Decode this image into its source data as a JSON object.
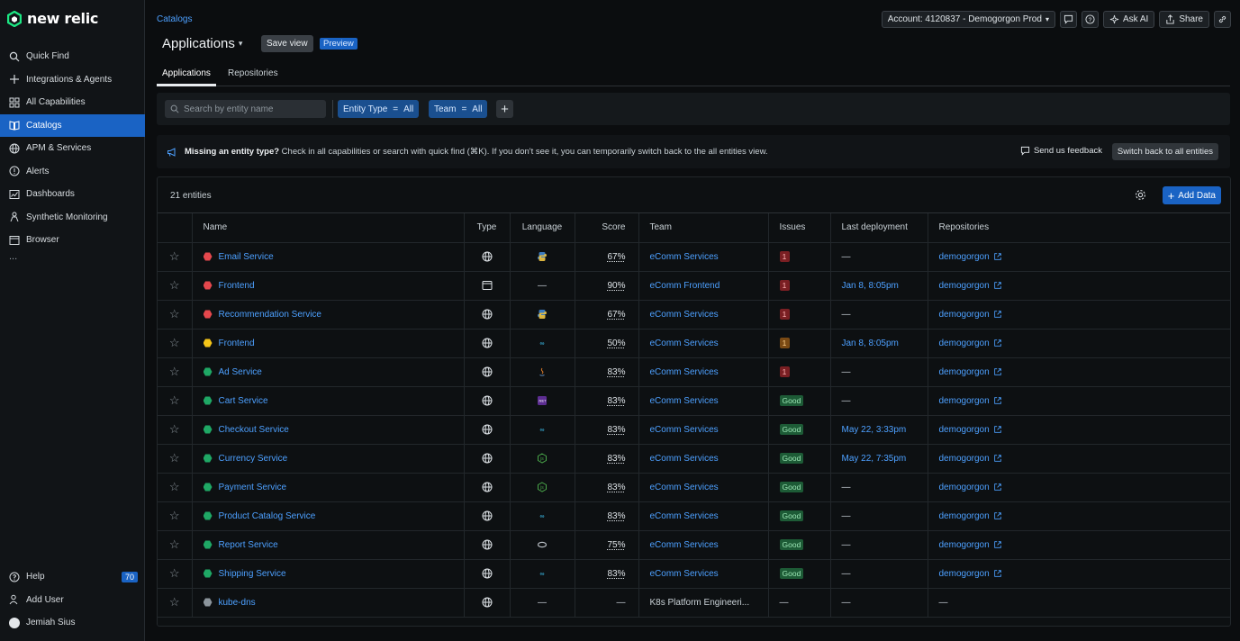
{
  "brand": {
    "name": "new relic"
  },
  "sidebar": {
    "items": [
      {
        "label": "Quick Find",
        "icon": "search-icon"
      },
      {
        "label": "Integrations & Agents",
        "icon": "plus-icon"
      },
      {
        "label": "All Capabilities",
        "icon": "grid-icon"
      },
      {
        "label": "Catalogs",
        "icon": "book-icon",
        "active": true
      },
      {
        "label": "APM & Services",
        "icon": "globe-icon"
      },
      {
        "label": "Alerts",
        "icon": "alert-icon"
      },
      {
        "label": "Dashboards",
        "icon": "dashboard-icon"
      },
      {
        "label": "Synthetic Monitoring",
        "icon": "person-icon"
      },
      {
        "label": "Browser",
        "icon": "browser-icon"
      }
    ],
    "more": "...",
    "bottom": [
      {
        "label": "Help",
        "icon": "help-icon",
        "badge": "70"
      },
      {
        "label": "Add User",
        "icon": "add-user-icon"
      },
      {
        "label": "Jemiah Sius",
        "icon": "avatar"
      }
    ]
  },
  "header": {
    "breadcrumb": "Catalogs",
    "title": "Applications",
    "save_view": "Save view",
    "preview": "Preview",
    "account": "Account: 4120837 - Demogorgon Prod",
    "ask_ai": "Ask AI",
    "share": "Share"
  },
  "tabs": [
    {
      "label": "Applications",
      "active": true
    },
    {
      "label": "Repositories"
    }
  ],
  "filters": {
    "search_placeholder": "Search by entity name",
    "chips": [
      {
        "key": "Entity Type",
        "op": "=",
        "value": "All"
      },
      {
        "key": "Team",
        "op": "=",
        "value": "All"
      }
    ]
  },
  "banner": {
    "bold": "Missing an entity type?",
    "text": " Check in all capabilities or search with quick find (⌘K). If you don't see it, you can temporarily switch back to the all entities view.",
    "feedback": "Send us feedback",
    "switch": "Switch back to all entities"
  },
  "panel": {
    "count": "21 entities",
    "add_data": "Add Data",
    "columns": [
      "Name",
      "Type",
      "Language",
      "Score",
      "Team",
      "Issues",
      "Last deployment",
      "Repositories"
    ]
  },
  "colors": {
    "red": "#e5484d",
    "yellow": "#f5c518",
    "green": "#1fa865",
    "gray": "#8c959c",
    "accent": "#1a63c4"
  },
  "rows": [
    {
      "name": "Email Service",
      "status": "red",
      "type": "globe-icon",
      "lang": "python-icon",
      "score": "67%",
      "team": "eComm Services",
      "issue": "1",
      "issue_kind": "bad",
      "deploy": "—",
      "repo": "demogorgon"
    },
    {
      "name": "Frontend",
      "status": "red",
      "type": "browser-icon",
      "lang": "—",
      "score": "90%",
      "team": "eComm Frontend",
      "issue": "1",
      "issue_kind": "bad",
      "deploy": "Jan 8, 8:05pm",
      "repo": "demogorgon"
    },
    {
      "name": "Recommendation Service",
      "status": "red",
      "type": "globe-icon",
      "lang": "python-icon",
      "score": "67%",
      "team": "eComm Services",
      "issue": "1",
      "issue_kind": "bad",
      "deploy": "—",
      "repo": "demogorgon"
    },
    {
      "name": "Frontend",
      "status": "yellow",
      "type": "globe-icon",
      "lang": "go-icon",
      "score": "50%",
      "team": "eComm Services",
      "issue": "1",
      "issue_kind": "warn",
      "deploy": "Jan 8, 8:05pm",
      "repo": "demogorgon"
    },
    {
      "name": "Ad Service",
      "status": "green",
      "type": "globe-icon",
      "lang": "java-icon",
      "score": "83%",
      "team": "eComm Services",
      "issue": "1",
      "issue_kind": "bad",
      "deploy": "—",
      "repo": "demogorgon"
    },
    {
      "name": "Cart Service",
      "status": "green",
      "type": "globe-icon",
      "lang": "dotnet-icon",
      "score": "83%",
      "team": "eComm Services",
      "issue": "Good",
      "issue_kind": "good",
      "deploy": "—",
      "repo": "demogorgon"
    },
    {
      "name": "Checkout Service",
      "status": "green",
      "type": "globe-icon",
      "lang": "go-icon",
      "score": "83%",
      "team": "eComm Services",
      "issue": "Good",
      "issue_kind": "good",
      "deploy": "May 22, 3:33pm",
      "repo": "demogorgon"
    },
    {
      "name": "Currency Service",
      "status": "green",
      "type": "globe-icon",
      "lang": "node-icon",
      "score": "83%",
      "team": "eComm Services",
      "issue": "Good",
      "issue_kind": "good",
      "deploy": "May 22, 7:35pm",
      "repo": "demogorgon"
    },
    {
      "name": "Payment Service",
      "status": "green",
      "type": "globe-icon",
      "lang": "node-icon",
      "score": "83%",
      "team": "eComm Services",
      "issue": "Good",
      "issue_kind": "good",
      "deploy": "—",
      "repo": "demogorgon"
    },
    {
      "name": "Product Catalog Service",
      "status": "green",
      "type": "globe-icon",
      "lang": "go-icon",
      "score": "83%",
      "team": "eComm Services",
      "issue": "Good",
      "issue_kind": "good",
      "deploy": "—",
      "repo": "demogorgon"
    },
    {
      "name": "Report Service",
      "status": "green",
      "type": "globe-icon",
      "lang": "ruby-icon",
      "score": "75%",
      "team": "eComm Services",
      "issue": "Good",
      "issue_kind": "good",
      "deploy": "—",
      "repo": "demogorgon"
    },
    {
      "name": "Shipping Service",
      "status": "green",
      "type": "globe-icon",
      "lang": "go-icon",
      "score": "83%",
      "team": "eComm Services",
      "issue": "Good",
      "issue_kind": "good",
      "deploy": "—",
      "repo": "demogorgon"
    },
    {
      "name": "kube-dns",
      "status": "gray",
      "type": "globe-icon",
      "lang": "—",
      "score": "—",
      "team": "K8s Platform Engineeri...",
      "issue": "—",
      "issue_kind": "none",
      "deploy": "—",
      "repo": "—"
    }
  ]
}
